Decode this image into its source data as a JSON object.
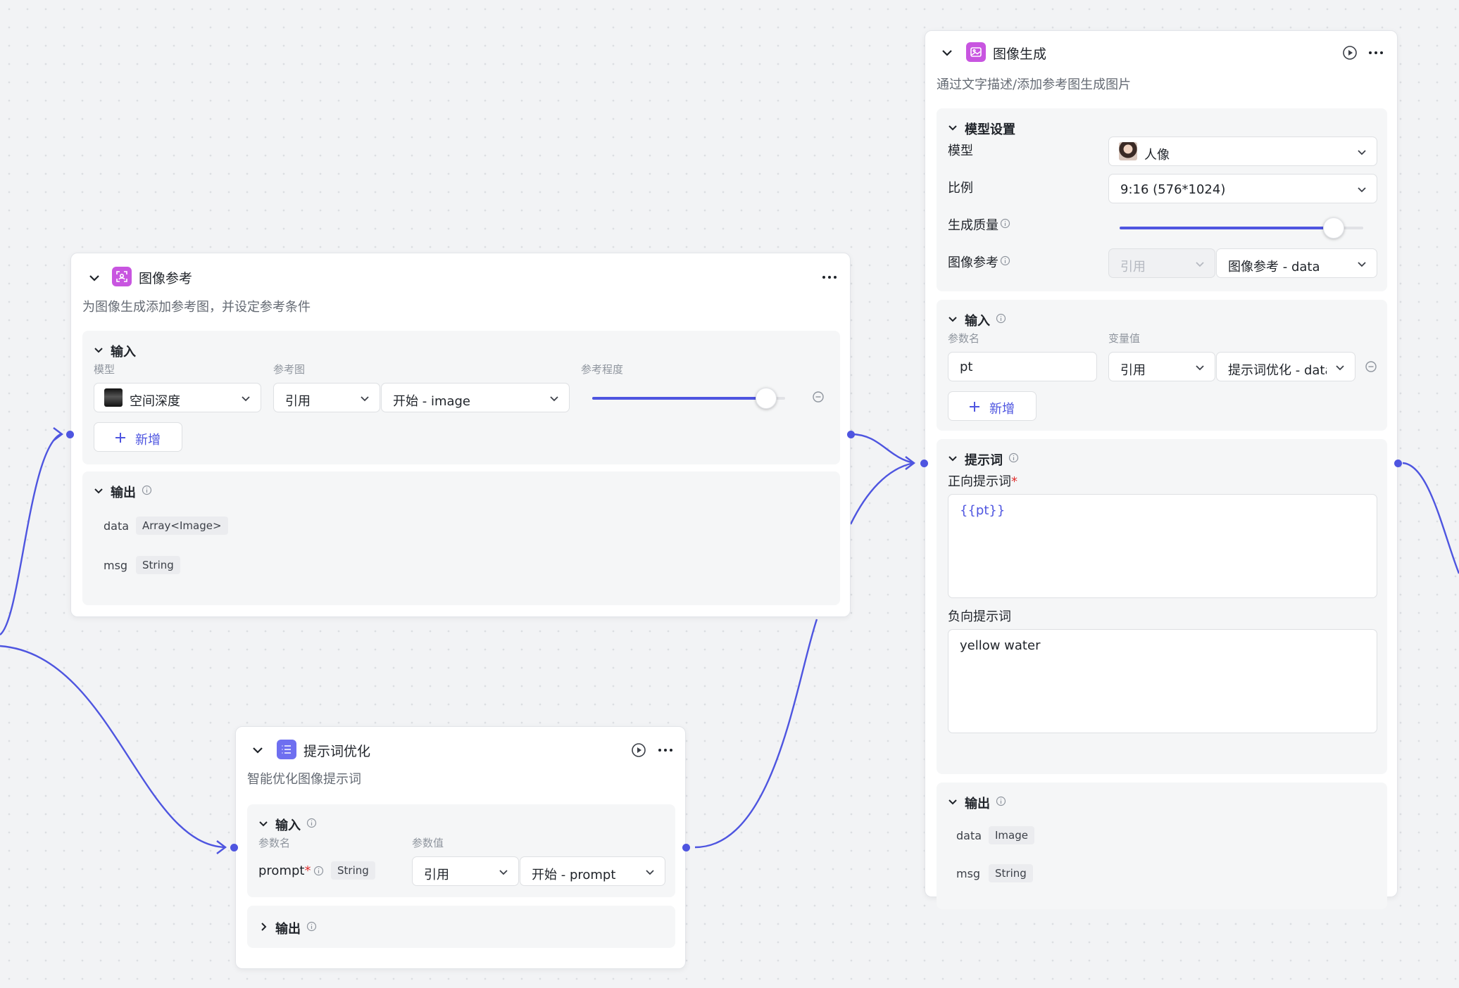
{
  "accent_color": "#4e55e0",
  "ref_node": {
    "title": "图像参考",
    "description": "为图像生成添加参考图，并设定参考条件",
    "more_icon": "ellipsis-icon",
    "input": {
      "title": "输入",
      "col_model": "模型",
      "col_ref_image": "参考图",
      "col_ref_strength": "参考程度",
      "model_value": "空间深度",
      "ref_type": "引用",
      "ref_source": "开始 - image",
      "strength": 0.9,
      "add_label": "新增"
    },
    "output": {
      "title": "输出",
      "items": [
        {
          "name": "data",
          "type": "Array<Image>"
        },
        {
          "name": "msg",
          "type": "String"
        }
      ]
    }
  },
  "opt_node": {
    "title": "提示词优化",
    "description": "智能优化图像提示词",
    "input": {
      "title": "输入",
      "col_param_name": "参数名",
      "col_param_value": "参数值",
      "param_name": "prompt",
      "required_mark": "*",
      "param_type": "String",
      "ref_type": "引用",
      "ref_source": "开始 - prompt"
    },
    "output": {
      "title": "输出"
    }
  },
  "gen_node": {
    "title": "图像生成",
    "description": "通过文字描述/添加参考图生成图片",
    "model_settings": {
      "title": "模型设置",
      "model_label": "模型",
      "model_value": "人像",
      "ratio_label": "比例",
      "ratio_value": "9:16 (576*1024)",
      "quality_label": "生成质量",
      "quality": 0.88,
      "ref_label": "图像参考",
      "ref_type": "引用",
      "ref_source": "图像参考 - data"
    },
    "input": {
      "title": "输入",
      "col_param_name": "参数名",
      "col_var_value": "变量值",
      "param_name": "pt",
      "ref_type": "引用",
      "ref_source": "提示词优化 - data",
      "add_label": "新增"
    },
    "prompt": {
      "title": "提示词",
      "positive_label": "正向提示词",
      "required_mark": "*",
      "positive_value": "{{pt}}",
      "negative_label": "负向提示词",
      "negative_value": "yellow water"
    },
    "output": {
      "title": "输出",
      "items": [
        {
          "name": "data",
          "type": "Image"
        },
        {
          "name": "msg",
          "type": "String"
        }
      ]
    }
  }
}
